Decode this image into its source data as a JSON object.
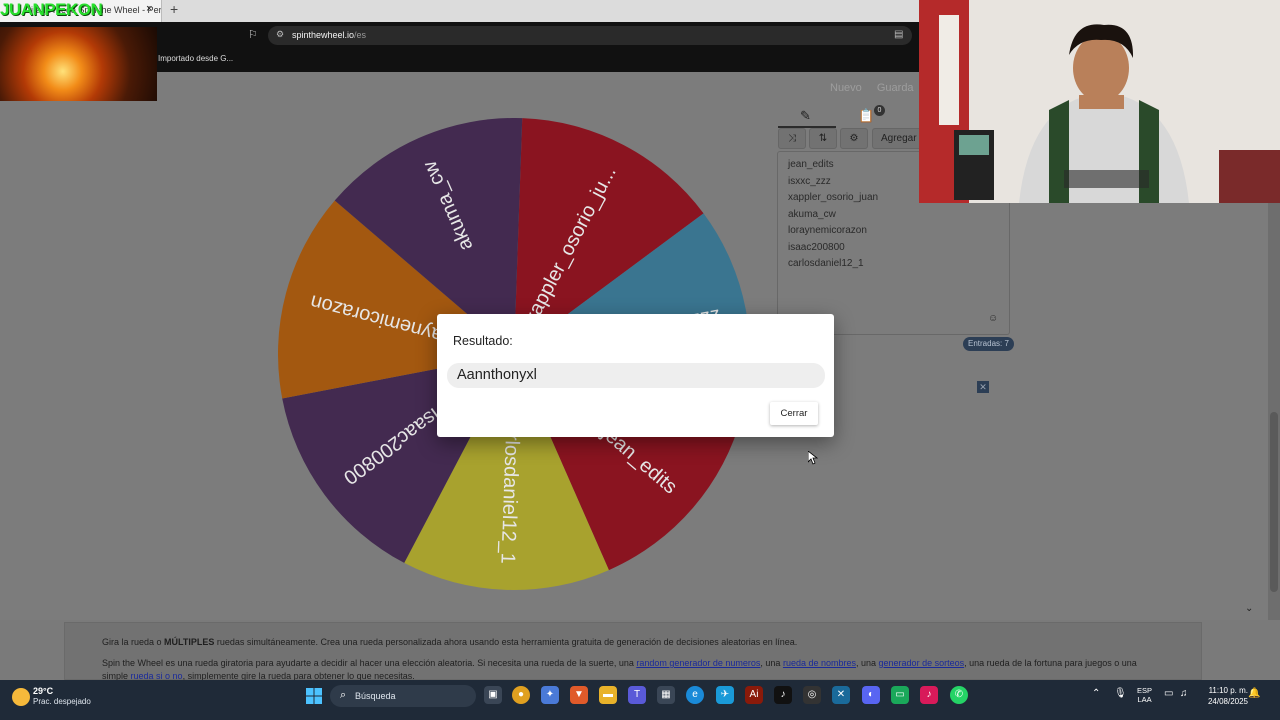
{
  "browser": {
    "tab_title": "Gira la rueda Spin the Wheel - Personaliza",
    "tab_close": "×",
    "new_tab": "+",
    "url_domain": "spinthewheel.io",
    "url_path": "/es",
    "bookmark": "Importado desde G..."
  },
  "overlay": {
    "streamer_name": "JUANPEKON"
  },
  "top_actions": {
    "new": "Nuevo",
    "save": "Guarda"
  },
  "wheel": {
    "segments": [
      {
        "label": "xappler_osorio_ju...",
        "color": "#8a1420"
      },
      {
        "label": "isxxc_zzz",
        "color": "#3a7590"
      },
      {
        "label": "jean_edits",
        "color": "#8a1420"
      },
      {
        "label": "carlosdaniel12_1",
        "color": "#a8a22e"
      },
      {
        "label": "isaac200800",
        "color": "#432a50"
      },
      {
        "label": "loraynemicorazon",
        "color": "#a35810"
      },
      {
        "label": "akuma_cw",
        "color": "#432a50"
      }
    ]
  },
  "panel": {
    "tabs": [
      "pencil-icon",
      "clipboard-icon"
    ],
    "badge": "0",
    "add_button": "Agregar",
    "entries": [
      "jean_edits",
      "isxxc_zzz",
      "xappler_osorio_juan",
      "akuma_cw",
      "loraynemicorazon",
      "isaac200800",
      "carlosdaniel12_1"
    ],
    "entries_count": "Entradas: 7"
  },
  "dialog": {
    "title": "Resultado:",
    "result": "Aannthonyxl",
    "close_label": "Cerrar"
  },
  "footer": {
    "line1_pre": "Gira la rueda o ",
    "line1_bold": "MÚLTIPLES",
    "line1_post": " ruedas simultáneamente. Crea una rueda personalizada ahora usando esta herramienta gratuita de generación de decisiones aleatorias en línea.",
    "line2_a": "Spin the Wheel es una rueda giratoria para ayudarte a decidir al hacer una elección aleatoria. Si necesita una rueda de la suerte, una ",
    "link_numbers": "random generador de numeros",
    "line2_b": ", una ",
    "link_names": "rueda de nombres",
    "line2_c": ", una ",
    "link_raffle": "generador de sorteos",
    "line2_d": ", una rueda de la fortuna para juegos o una",
    "line3_a": "simple ",
    "link_yesno": "rueda si o no",
    "line3_b": ", simplemente gire la rueda para obtener lo que necesitas."
  },
  "taskbar": {
    "temp": "29°C",
    "weather": "Prac. despejado",
    "search": "Búsqueda",
    "lang_line1": "ESP",
    "lang_line2": "LAA",
    "time": "11:10 p. m.",
    "date": "24/08/2025"
  },
  "colors": {
    "accent_green": "#27e02c",
    "dialog_bg": "#ffffff",
    "taskbar": "#1f2a38"
  }
}
